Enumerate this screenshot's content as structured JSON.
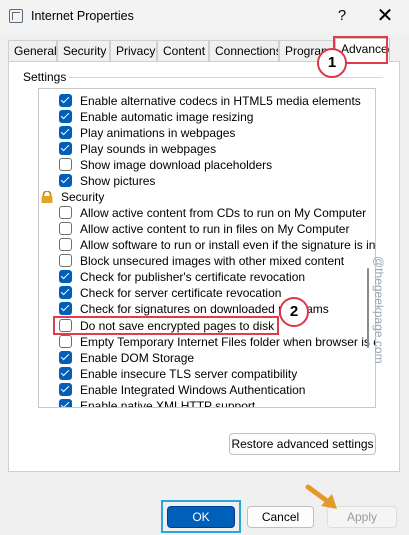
{
  "window": {
    "title": "Internet Properties",
    "help": "?",
    "close": "✕"
  },
  "tabs": [
    {
      "label": "General"
    },
    {
      "label": "Security"
    },
    {
      "label": "Privacy"
    },
    {
      "label": "Content"
    },
    {
      "label": "Connections"
    },
    {
      "label": "Programs"
    },
    {
      "label": "Advanced"
    }
  ],
  "settings": {
    "group_label": "Settings",
    "items": [
      {
        "label": "Enable alternative codecs in HTML5 media elements",
        "checked": true
      },
      {
        "label": "Enable automatic image resizing",
        "checked": true
      },
      {
        "label": "Play animations in webpages",
        "checked": true
      },
      {
        "label": "Play sounds in webpages",
        "checked": true
      },
      {
        "label": "Show image download placeholders",
        "checked": false
      },
      {
        "label": "Show pictures",
        "checked": true
      },
      {
        "label": "Security",
        "section": true
      },
      {
        "label": "Allow active content from CDs to run on My Computer",
        "checked": false
      },
      {
        "label": "Allow active content to run in files on My Computer",
        "checked": false
      },
      {
        "label": "Allow software to run or install even if the signature is invalid",
        "checked": false
      },
      {
        "label": "Block unsecured images with other mixed content",
        "checked": false
      },
      {
        "label": "Check for publisher's certificate revocation",
        "checked": true
      },
      {
        "label": "Check for server certificate revocation",
        "checked": true
      },
      {
        "label": "Check for signatures on downloaded programs",
        "checked": true
      },
      {
        "label": "Do not save encrypted pages to disk",
        "checked": false
      },
      {
        "label": "Empty Temporary Internet Files folder when browser is closed",
        "checked": false
      },
      {
        "label": "Enable DOM Storage",
        "checked": true
      },
      {
        "label": "Enable insecure TLS server compatibility",
        "checked": true
      },
      {
        "label": "Enable Integrated Windows Authentication",
        "checked": true
      },
      {
        "label": "Enable native XMLHTTP support",
        "checked": true
      }
    ]
  },
  "buttons": {
    "restore": "Restore advanced settings",
    "ok": "OK",
    "cancel": "Cancel",
    "apply": "Apply"
  },
  "annotations": {
    "step1": "1",
    "step2": "2"
  },
  "watermark": "@thegeekpage.com",
  "colors": {
    "accent": "#005fb8",
    "highlight_red": "#e23b4a",
    "highlight_blue": "#2aa6d8",
    "cursor": "#e39a2d"
  }
}
